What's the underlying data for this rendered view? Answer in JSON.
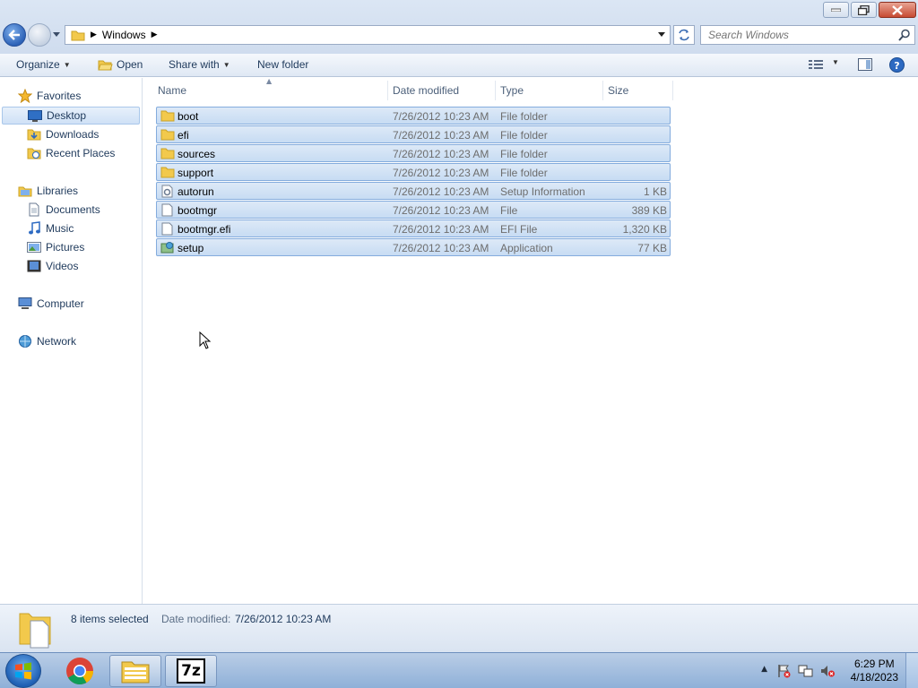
{
  "window": {
    "controls": [
      "minimize",
      "maximize",
      "close"
    ]
  },
  "address": {
    "crumbs": [
      "Windows"
    ]
  },
  "search": {
    "placeholder": "Search Windows"
  },
  "toolbar": {
    "organize": "Organize",
    "open": "Open",
    "share_with": "Share with",
    "new_folder": "New folder"
  },
  "navpane": {
    "favorites": "Favorites",
    "desktop": "Desktop",
    "downloads": "Downloads",
    "recent_places": "Recent Places",
    "libraries": "Libraries",
    "documents": "Documents",
    "music": "Music",
    "pictures": "Pictures",
    "videos": "Videos",
    "computer": "Computer",
    "network": "Network"
  },
  "columns": {
    "name": "Name",
    "date_modified": "Date modified",
    "type": "Type",
    "size": "Size"
  },
  "files": [
    {
      "name": "boot",
      "date": "7/26/2012 10:23 AM",
      "type": "File folder",
      "size": "",
      "icon": "folder-icon"
    },
    {
      "name": "efi",
      "date": "7/26/2012 10:23 AM",
      "type": "File folder",
      "size": "",
      "icon": "folder-icon"
    },
    {
      "name": "sources",
      "date": "7/26/2012 10:23 AM",
      "type": "File folder",
      "size": "",
      "icon": "folder-icon"
    },
    {
      "name": "support",
      "date": "7/26/2012 10:23 AM",
      "type": "File folder",
      "size": "",
      "icon": "folder-icon"
    },
    {
      "name": "autorun",
      "date": "7/26/2012 10:23 AM",
      "type": "Setup Information",
      "size": "1 KB",
      "icon": "setup-info-icon"
    },
    {
      "name": "bootmgr",
      "date": "7/26/2012 10:23 AM",
      "type": "File",
      "size": "389 KB",
      "icon": "file-icon"
    },
    {
      "name": "bootmgr.efi",
      "date": "7/26/2012 10:23 AM",
      "type": "EFI File",
      "size": "1,320 KB",
      "icon": "file-icon"
    },
    {
      "name": "setup",
      "date": "7/26/2012 10:23 AM",
      "type": "Application",
      "size": "77 KB",
      "icon": "application-icon"
    }
  ],
  "details": {
    "count": "8 items selected",
    "date_label": "Date modified:",
    "date_value": "7/26/2012 10:23 AM"
  },
  "taskbar": {
    "items": [
      "chrome-icon",
      "explorer-icon",
      "7zip-icon"
    ],
    "seven_zip_label": "7z",
    "time": "6:29 PM",
    "date": "4/18/2023"
  },
  "colors": {
    "selection_bg": "#cfe1f6",
    "selection_border": "#84acdd",
    "taskbar": "#a9c3e3",
    "text": "#1e395b"
  }
}
